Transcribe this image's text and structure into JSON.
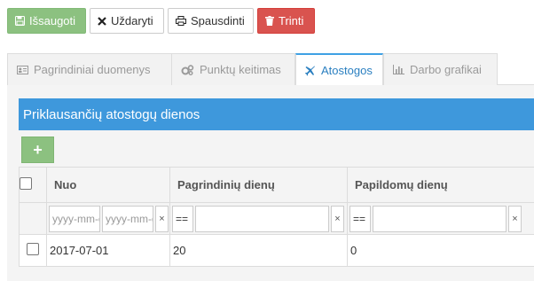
{
  "toolbar": {
    "save_label": "Išsaugoti",
    "close_label": "Uždaryti",
    "print_label": "Spausdinti",
    "delete_label": "Trinti"
  },
  "tabs": [
    {
      "label": "Pagrindiniai duomenys",
      "icon": "id-card-icon",
      "active": false
    },
    {
      "label": "Punktų keitimas",
      "icon": "cogs-icon",
      "active": false
    },
    {
      "label": "Atostogos",
      "icon": "plane-icon",
      "active": true
    },
    {
      "label": "Darbo grafikai",
      "icon": "bar-chart-icon",
      "active": false
    }
  ],
  "panel": {
    "title": "Priklausančių atostogų dienos",
    "add_label": "+"
  },
  "grid": {
    "columns": [
      "Nuo",
      "Pagrindinių dienų",
      "Papildomų dienų"
    ],
    "filters": {
      "date_from_placeholder": "yyyy-mm-dd",
      "date_to_placeholder": "yyyy-mm-dd",
      "clear": "×",
      "main_op": "==",
      "extra_op": "=="
    },
    "rows": [
      {
        "from": "2017-07-01",
        "main_days": "20",
        "extra_days": "0"
      }
    ]
  },
  "colors": {
    "green": "#8cc180",
    "red": "#d9534f",
    "blue_header": "#3e98dc",
    "active_tab": "#2a7fc0"
  }
}
